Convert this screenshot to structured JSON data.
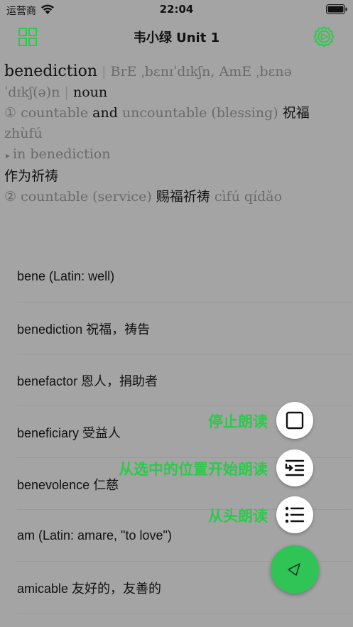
{
  "status_bar": {
    "carrier": "运营商",
    "time": "22:04"
  },
  "nav": {
    "title": "韦小绿 Unit 1",
    "left_icon": "grid-icon",
    "right_icon": "gear-icon"
  },
  "entry": {
    "headword": "benediction",
    "sep": "|",
    "pron_bre": "BrE ˌbɛnɪˈdɪkʃn, AmE ˌbɛnə",
    "pron_ame_cont": "ˈdɪkʃ(ə)n",
    "pos": "noun",
    "sense1_num": "①",
    "sense1_countable": "countable",
    "sense1_and": "and",
    "sense1_uncountable": "uncountable (blessing)",
    "sense1_cn": "祝福",
    "sense1_pinyin": "zhùfú",
    "phrase_marker": "▸",
    "phrase": "in benediction",
    "phrase_cn": "作为祈祷",
    "sense2_num": "②",
    "sense2_label": "countable (service)",
    "sense2_cn": "赐福祈祷",
    "sense2_pinyin": "cìfú qídǎo"
  },
  "list": [
    "bene (Latin: well)",
    "benediction 祝福，祷告",
    "benefactor 恩人，捐助者",
    "beneficiary 受益人",
    "benevolence 仁慈",
    "am (Latin: amare, \"to love\")",
    "amicable 友好的，友善的"
  ],
  "fab_menu": {
    "stop_label": "停止朗读",
    "from_selected_label": "从选中的位置开始朗读",
    "from_start_label": "从头朗读",
    "accent_color": "#2cc94c"
  }
}
